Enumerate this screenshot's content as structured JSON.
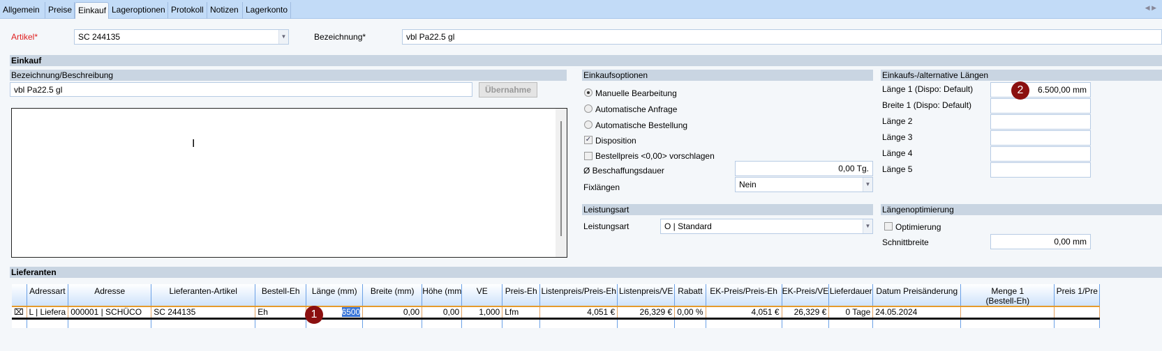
{
  "tabs": [
    "Allgemein",
    "Preise",
    "Einkauf",
    "Lageroptionen",
    "Protokoll",
    "Notizen",
    "Lagerkonto"
  ],
  "active_tab": "Einkauf",
  "header": {
    "artikel_label": "Artikel*",
    "artikel_value": "SC  244135",
    "bezeichnung_label": "Bezeichnung*",
    "bezeichnung_value": "vbl Pa22.5 gl"
  },
  "einkauf": {
    "title": "Einkauf",
    "beschreibung_title": "Bezeichnung/Beschreibung",
    "beschreibung_value": "vbl Pa22.5 gl",
    "uebernahme_button": "Übernahme",
    "description_text": ""
  },
  "einkaufsoptionen": {
    "title": "Einkaufsoptionen",
    "radios": [
      {
        "label": "Manuelle Bearbeitung",
        "checked": true
      },
      {
        "label": "Automatische Anfrage",
        "checked": false
      },
      {
        "label": "Automatische Bestellung",
        "checked": false
      }
    ],
    "disposition": {
      "label": "Disposition",
      "checked": true
    },
    "bestellpreis": {
      "label": "Bestellpreis <0,00> vorschlagen",
      "checked": false
    },
    "beschaffungsdauer_label": "Ø Beschaffungsdauer",
    "beschaffungsdauer_value": "0,00 Tg.",
    "fixlaengen_label": "Fixlängen",
    "fixlaengen_value": "Nein"
  },
  "laengen": {
    "title": "Einkaufs-/alternative Längen",
    "rows": [
      {
        "label": "Länge 1 (Dispo: Default)",
        "value": "6.500,00 mm"
      },
      {
        "label": "Breite 1 (Dispo: Default)",
        "value": ""
      },
      {
        "label": "Länge 2",
        "value": ""
      },
      {
        "label": "Länge 3",
        "value": ""
      },
      {
        "label": "Länge 4",
        "value": ""
      },
      {
        "label": "Länge 5",
        "value": ""
      }
    ]
  },
  "leistungsart": {
    "title": "Leistungsart",
    "label": "Leistungsart",
    "value": "O | Standard"
  },
  "laengenoptimierung": {
    "title": "Längenoptimierung",
    "optimierung_label": "Optimierung",
    "optimierung_checked": false,
    "schnittbreite_label": "Schnittbreite",
    "schnittbreite_value": "0,00 mm"
  },
  "lieferanten": {
    "title": "Lieferanten",
    "columns": [
      "",
      "Adressart",
      "Adresse",
      "Lieferanten-Artikel",
      "Bestell-Eh",
      "Länge (mm)",
      "Breite (mm)",
      "Höhe (mm",
      "VE",
      "Preis-Eh",
      "Listenpreis/Preis-Eh",
      "Listenpreis/VE",
      "Rabatt",
      "EK-Preis/Preis-Eh",
      "EK-Preis/VE",
      "Lieferdauer",
      "Datum Preisänderung",
      "Menge 1\n(Bestell-Eh)",
      "Preis 1/Pre"
    ],
    "rows": [
      [
        "⌧",
        "L | Liefera",
        "000001 | SCHÜCO",
        "SC  244135",
        "Eh",
        "6500",
        "0,00",
        "0,00",
        "1,000",
        "Lfm",
        "4,051 €",
        "26,329 €",
        "0,00 %",
        "4,051 €",
        "26,329 €",
        "0 Tage",
        "24.05.2024",
        "",
        ""
      ]
    ]
  },
  "badges": [
    "1",
    "2"
  ],
  "colors": {
    "required_label": "#e02020",
    "badge": "#8b1010",
    "tabbar": "#c2dbf7",
    "section": "#c9d5e2",
    "selection": "#3875d7"
  }
}
